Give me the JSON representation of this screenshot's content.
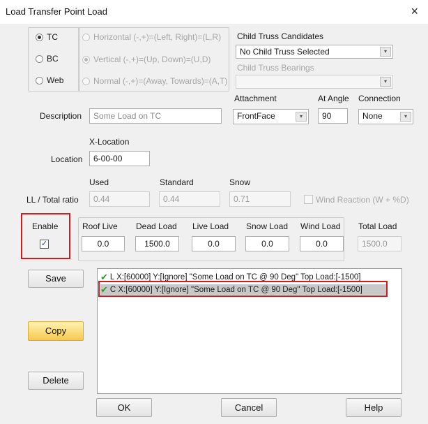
{
  "window": {
    "title": "Load Transfer Point Load",
    "close": "×"
  },
  "chord": {
    "tc": "TC",
    "bc": "BC",
    "web": "Web",
    "selected": "TC"
  },
  "direction": {
    "horizontal": "Horizontal (-,+)=(Left, Right)=(L,R)",
    "vertical": "Vertical (-,+)=(Up, Down)=(U,D)",
    "normal": "Normal (-,+)=(Away, Towards)=(A,T)",
    "selected": "vertical"
  },
  "child_truss": {
    "candidates_label": "Child Truss Candidates",
    "candidates_value": "No Child Truss Selected",
    "bearings_label": "Child Truss Bearings",
    "bearings_value": ""
  },
  "description": {
    "label": "Description",
    "value": "Some Load on TC"
  },
  "attachment": {
    "label": "Attachment",
    "value": "FrontFace"
  },
  "at_angle": {
    "label": "At Angle",
    "value": "90"
  },
  "connection": {
    "label": "Connection",
    "value": "None"
  },
  "location": {
    "xlabel": "X-Location",
    "label": "Location",
    "value": "6-00-00"
  },
  "ratio": {
    "label": "LL / Total ratio",
    "used_label": "Used",
    "used_value": "0.44",
    "standard_label": "Standard",
    "standard_value": "0.44",
    "snow_label": "Snow",
    "snow_value": "0.71",
    "wind_reaction": "Wind Reaction (W + %D)"
  },
  "enable": {
    "label": "Enable",
    "checked": "✓"
  },
  "loads": {
    "roof_live_label": "Roof Live",
    "roof_live": "0.0",
    "dead_label": "Dead Load",
    "dead": "1500.0",
    "live_label": "Live Load",
    "live": "0.0",
    "snow_label": "Snow Load",
    "snow": "0.0",
    "wind_label": "Wind Load",
    "wind": "0.0",
    "total_label": "Total Load",
    "total": "1500.0"
  },
  "buttons": {
    "save": "Save",
    "copy": "Copy",
    "delete": "Delete",
    "ok": "OK",
    "cancel": "Cancel",
    "help": "Help"
  },
  "load_list": [
    "L X:[60000] Y:[Ignore] \"Some Load on TC @ 90 Deg\" Top Load:[-1500]",
    "C X:[60000] Y:[Ignore] \"Some Load on TC @ 90 Deg\" Top Load:[-1500]"
  ],
  "colors": {
    "highlight": "#d01c1c",
    "selected_row": "#c8c8c8",
    "check": "#2a9d2a"
  }
}
